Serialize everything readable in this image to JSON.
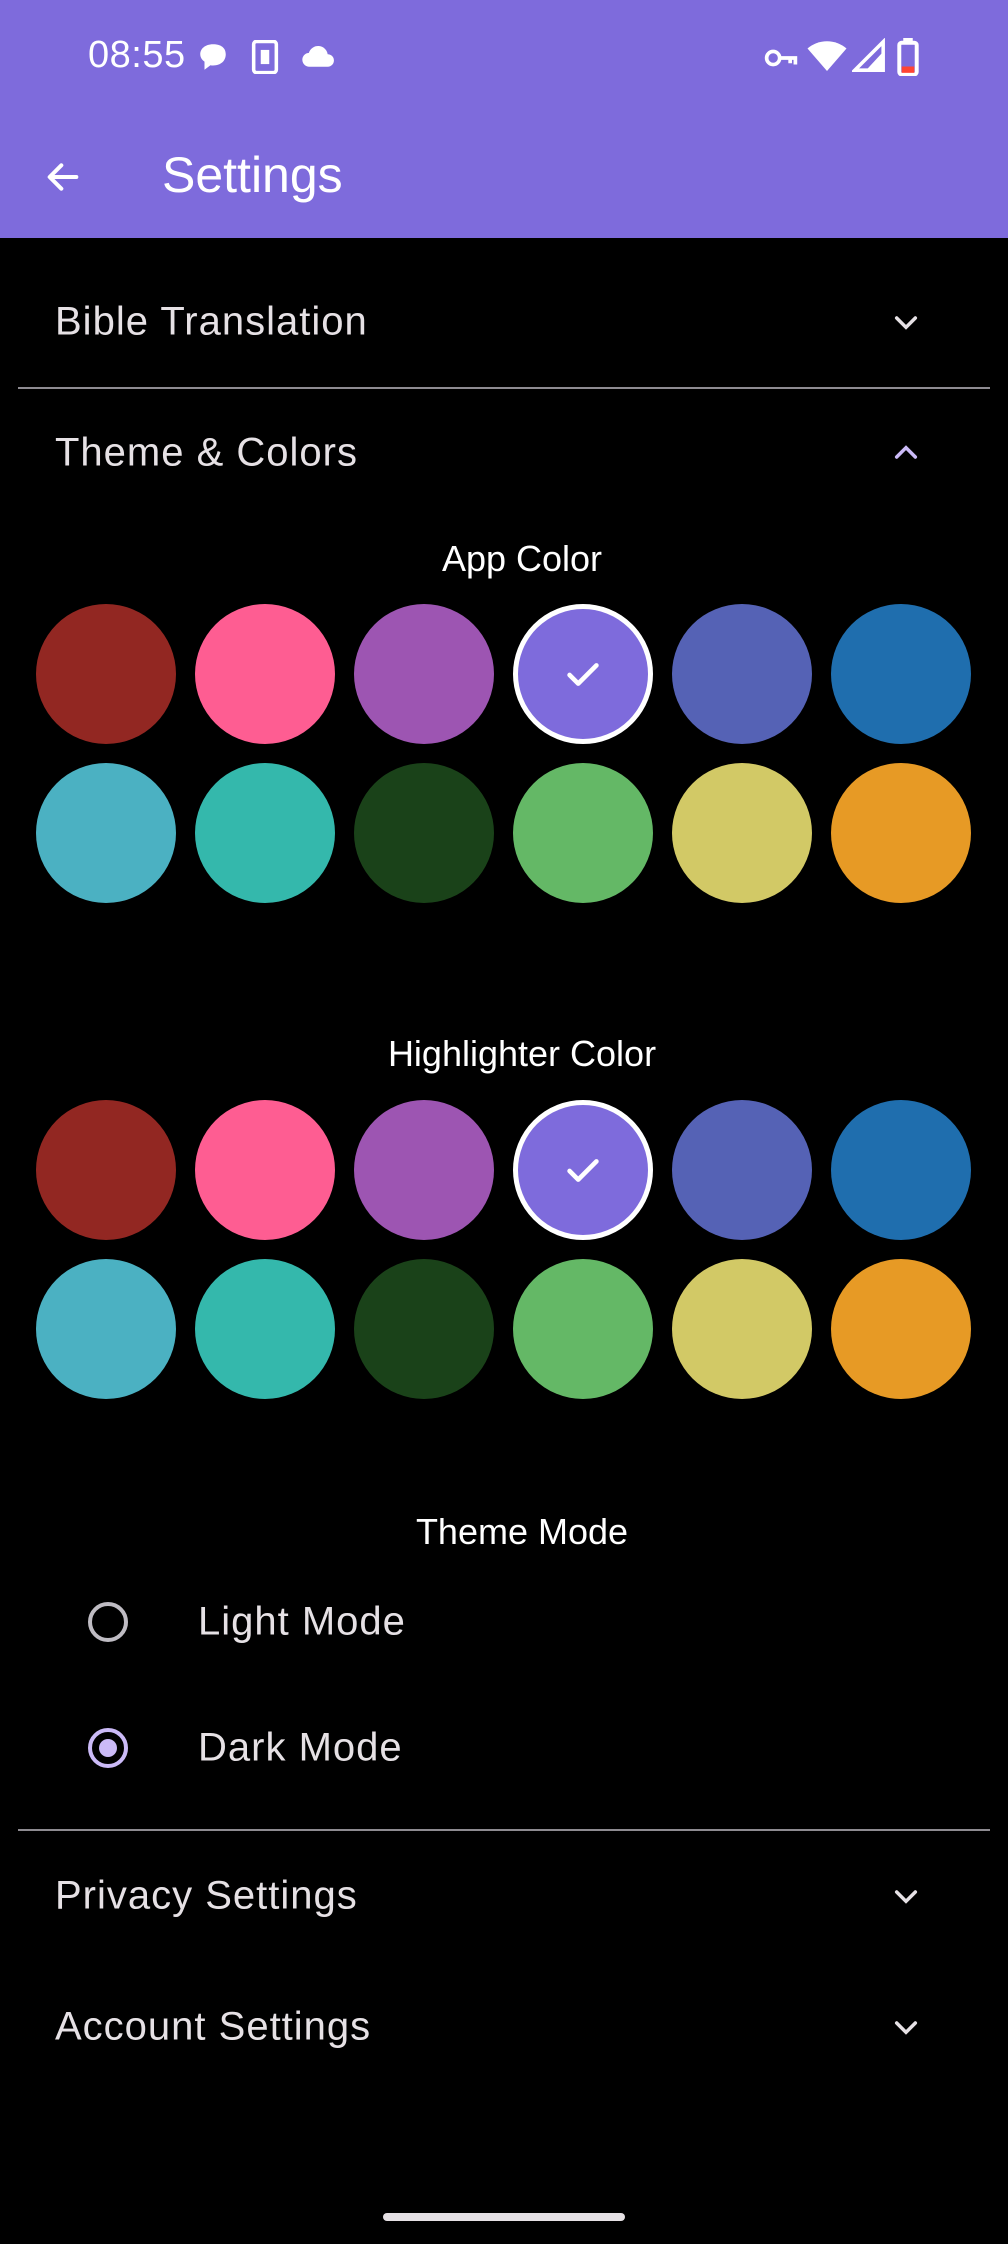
{
  "status_bar": {
    "time": "08:55",
    "left_icons": [
      "chat-bubble-icon",
      "sim-card-icon",
      "cloud-icon"
    ],
    "right_icons": [
      "vpn-key-icon",
      "wifi-icon",
      "cell-signal-icon",
      "battery-low-icon"
    ]
  },
  "app_bar": {
    "title": "Settings",
    "back_icon": "arrow-back-icon",
    "background": "#7e6bdc"
  },
  "sections": {
    "bible_translation": {
      "label": "Bible Translation",
      "expanded": false
    },
    "theme_colors": {
      "label": "Theme & Colors",
      "expanded": true
    },
    "privacy": {
      "label": "Privacy Settings",
      "expanded": false
    },
    "account": {
      "label": "Account Settings",
      "expanded": false
    }
  },
  "app_color": {
    "heading": "App Color",
    "selected_index": 3,
    "colors": [
      "#922722",
      "#fe5d92",
      "#9d55b2",
      "#7e6bdc",
      "#5562b5",
      "#1f6eae",
      "#4bb1c2",
      "#34b8ac",
      "#1a4219",
      "#64b866",
      "#d2c966",
      "#e79a25"
    ]
  },
  "highlighter_color": {
    "heading": "Highlighter Color",
    "selected_index": 3,
    "colors": [
      "#922722",
      "#fe5d92",
      "#9d55b2",
      "#7e6bdc",
      "#5562b5",
      "#1f6eae",
      "#4bb1c2",
      "#34b8ac",
      "#1a4219",
      "#64b866",
      "#d2c966",
      "#e79a25"
    ]
  },
  "theme_mode": {
    "heading": "Theme Mode",
    "options": [
      {
        "label": "Light Mode",
        "selected": false
      },
      {
        "label": "Dark Mode",
        "selected": true
      }
    ]
  }
}
